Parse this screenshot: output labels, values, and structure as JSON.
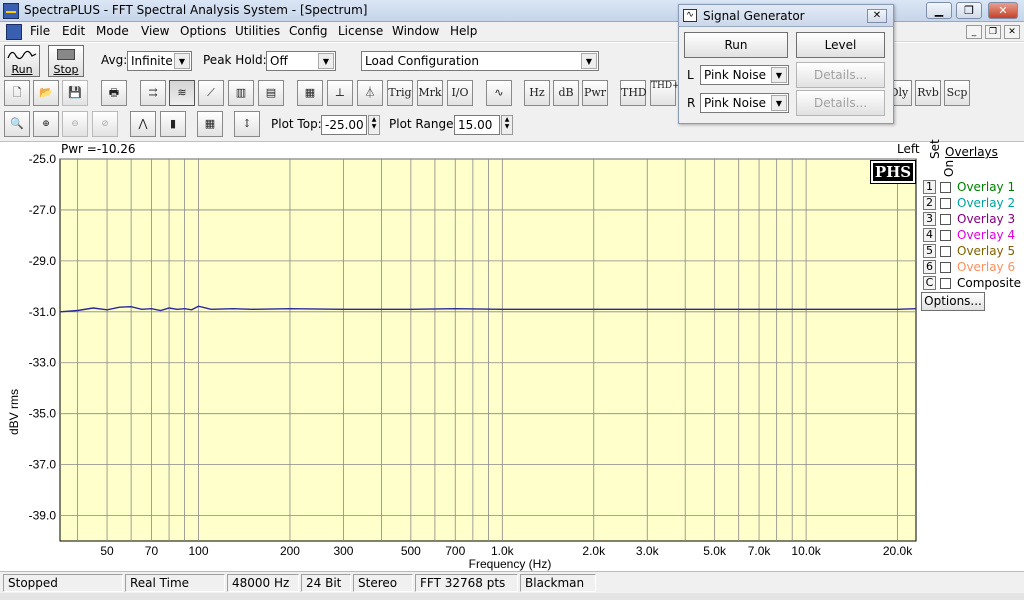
{
  "window": {
    "title": "SpectraPLUS - FFT Spectral Analysis System - [Spectrum]",
    "minimize_glyph": "▁",
    "maximize_glyph": "❐",
    "close_glyph": "✕"
  },
  "menu": {
    "items": [
      "File",
      "Edit",
      "Mode",
      "View",
      "Options",
      "Utilities",
      "Config",
      "License",
      "Window",
      "Help"
    ],
    "mdi_controls": [
      "_",
      "❐",
      "✕"
    ]
  },
  "toolbar1": {
    "run_label": "Run",
    "stop_label": "Stop",
    "avg_label": "Avg:",
    "avg_value": "Infinite",
    "peak_hold_label": "Peak Hold:",
    "peak_hold_value": "Off",
    "config_value": "Load Configuration"
  },
  "toolbar2": {
    "buttons": [
      "Trig",
      "Mrk",
      "I/O",
      "Hz",
      "dB",
      "Pwr",
      "THD",
      "THD+N",
      "Dly",
      "Rvb",
      "Scp"
    ]
  },
  "toolbar3": {
    "plot_top_label": "Plot Top:",
    "plot_top_value": "-25.00",
    "plot_range_label": "Plot Range:",
    "plot_range_value": "15.00"
  },
  "plot": {
    "power_readout": "Pwr =-10.26",
    "channel_label": "Left",
    "logo_text": "PHS",
    "colors": {
      "background": "#ffffcc",
      "grid": "#888888",
      "trace": "#2a2a9a"
    }
  },
  "chart_data": {
    "type": "line",
    "title": "",
    "xlabel": "Frequency (Hz)",
    "ylabel": "dBV rms",
    "xscale": "log",
    "xlim": [
      35,
      23000
    ],
    "ylim": [
      -40.0,
      -25.0
    ],
    "yticks": [
      -25.0,
      -27.0,
      -29.0,
      -31.0,
      -33.0,
      -35.0,
      -37.0,
      -39.0
    ],
    "ytick_labels": [
      "-25.0",
      "-27.0",
      "-29.0",
      "-31.0",
      "-33.0",
      "-35.0",
      "-37.0",
      "-39.0"
    ],
    "xtick_values": [
      50,
      70,
      100,
      200,
      300,
      500,
      700,
      1000,
      2000,
      3000,
      5000,
      7000,
      10000,
      20000
    ],
    "xtick_labels": [
      "50",
      "70",
      "100",
      "200",
      "300",
      "500",
      "700",
      "1.0k",
      "2.0k",
      "3.0k",
      "5.0k",
      "7.0k",
      "10.0k",
      "20.0k"
    ],
    "grid": true,
    "series": [
      {
        "x": [
          35,
          40,
          45,
          50,
          55,
          60,
          65,
          70,
          75,
          80,
          85,
          90,
          95,
          100,
          110,
          130,
          150,
          200,
          300,
          500,
          700,
          1000,
          2000,
          3000,
          5000,
          7000,
          10000,
          20000,
          23000
        ],
        "values": [
          -31.0,
          -30.95,
          -30.85,
          -30.92,
          -30.82,
          -30.8,
          -30.9,
          -30.88,
          -30.95,
          -30.85,
          -30.9,
          -30.88,
          -30.92,
          -30.78,
          -30.9,
          -30.88,
          -30.9,
          -30.88,
          -30.9,
          -30.9,
          -30.88,
          -30.9,
          -30.9,
          -30.9,
          -30.9,
          -30.9,
          -30.9,
          -30.9,
          -30.88
        ]
      }
    ]
  },
  "overlays": {
    "header": "Overlays",
    "set_label": "Set",
    "on_label": "On",
    "items": [
      {
        "set": "1",
        "label": "Overlay 1",
        "color": "#008000"
      },
      {
        "set": "2",
        "label": "Overlay 2",
        "color": "#00a0a0"
      },
      {
        "set": "3",
        "label": "Overlay 3",
        "color": "#800080"
      },
      {
        "set": "4",
        "label": "Overlay 4",
        "color": "#e000e0"
      },
      {
        "set": "5",
        "label": "Overlay 5",
        "color": "#806000"
      },
      {
        "set": "6",
        "label": "Overlay 6",
        "color": "#ff9060"
      },
      {
        "set": "C",
        "label": "Composite",
        "color": "#000000"
      }
    ],
    "options_label": "Options..."
  },
  "status": {
    "cells": [
      "Stopped",
      "Real Time",
      "48000 Hz",
      "24 Bit",
      "Stereo",
      "FFT 32768 pts",
      "Blackman"
    ]
  },
  "signal_generator": {
    "title": "Signal Generator",
    "run_label": "Run",
    "level_label": "Level",
    "left_label": "L",
    "right_label": "R",
    "left_value": "Pink Noise",
    "right_value": "Pink Noise",
    "details_label": "Details..."
  }
}
